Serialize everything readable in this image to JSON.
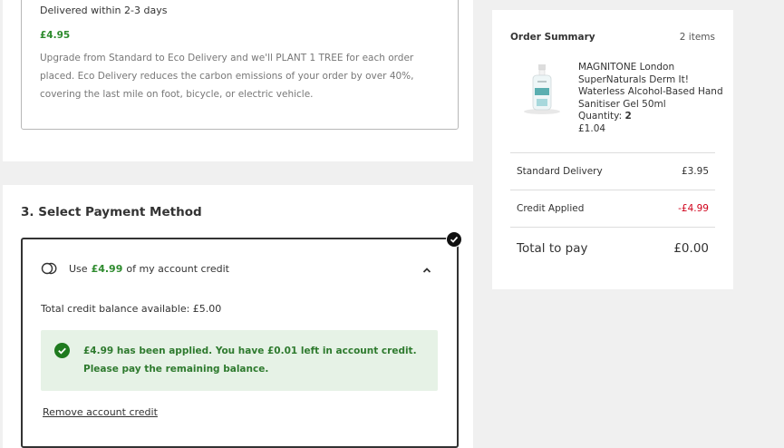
{
  "delivery": {
    "subtitle": "Delivered within 2-3 days",
    "price": "£4.95",
    "description": "Upgrade from Standard to Eco Delivery and we'll PLANT 1 TREE for each order placed. Eco Delivery reduces the carbon emissions of your order by over 40%, covering the last mile on foot, bicycle, or electric vehicle."
  },
  "payment": {
    "title": "3. Select Payment Method",
    "credit_prefix": "Use",
    "credit_amount": "£4.99",
    "credit_suffix": "of my account credit",
    "balance_text": "Total credit balance available: £5.00",
    "applied_message": "£4.99 has been applied. You have £0.01 left in account credit. Please pay the remaining balance.",
    "remove_link": "Remove account credit"
  },
  "summary": {
    "title": "Order Summary",
    "item_count": "2 items",
    "product": {
      "name": "MAGNITONE London SuperNaturals Derm It! Waterless Alcohol-Based Hand Sanitiser Gel 50ml",
      "quantity_label": "Quantity:",
      "quantity": "2",
      "price": "£1.04"
    },
    "rows": [
      {
        "label": "Standard Delivery",
        "value": "£3.95"
      },
      {
        "label": "Credit Applied",
        "value": "-£4.99"
      }
    ],
    "total_label": "Total to pay",
    "total_value": "£0.00"
  },
  "colors": {
    "green": "#2e8b2e",
    "red": "#d0021b",
    "applied_bg": "#e6f2e6",
    "page_bg": "#f0f0f0"
  },
  "icons": [
    "coins-icon",
    "chevron-up-icon",
    "check-circle-icon",
    "checkmark-badge-icon",
    "product-image"
  ]
}
